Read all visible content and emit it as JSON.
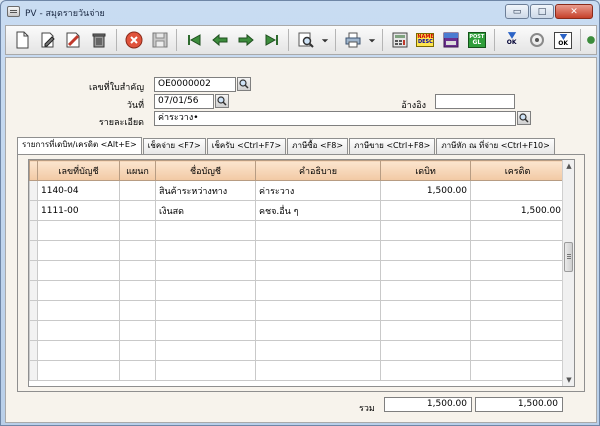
{
  "window": {
    "title": "PV - สมุดรายวันจ่าย"
  },
  "window_controls": {
    "minimize": "▭",
    "maximize": "□",
    "close": "✕"
  },
  "toolbar": {
    "icons": [
      "new-icon",
      "edit-icon",
      "delete-icon",
      "trash-icon",
      "cancel-icon",
      "save-icon",
      "first-icon",
      "prev-icon",
      "next-icon",
      "last-icon",
      "find-icon",
      "print-icon",
      "calculator-icon",
      "name-desc-icon",
      "report-icon",
      "post-gl-icon",
      "ok-icon",
      "attach-icon",
      "approve-icon",
      "exit-icon"
    ],
    "name_desc_label_1": "NAME",
    "name_desc_label_2": "DESC",
    "post_gl_label_1": "POST",
    "post_gl_label_2": "GL",
    "ok_label": "OK",
    "approve_label": "OK"
  },
  "form": {
    "doc_no_label": "เลขที่ใบสำคัญ",
    "doc_no_value": "OE0000002",
    "date_label": "วันที่",
    "date_value": "07/01/56",
    "reference_label": "อ้างอิง",
    "reference_value": "",
    "detail_label": "รายละเอียด",
    "detail_value": "ค่าระวาง•"
  },
  "tabs": [
    {
      "label": "รายการที่เดบิท/เครดิต <Alt+E>",
      "active": true
    },
    {
      "label": "เช็คจ่าย <F7>"
    },
    {
      "label": "เช็ครับ <Ctrl+F7>"
    },
    {
      "label": "ภาษีซื้อ <F8>"
    },
    {
      "label": "ภาษีขาย <Ctrl+F8>"
    },
    {
      "label": "ภาษีหัก ณ ที่จ่าย <Ctrl+F10>"
    }
  ],
  "grid": {
    "columns": [
      "เลขที่บัญชี",
      "แผนก",
      "ชื่อบัญชี",
      "คำอธิบาย",
      "เดบิท",
      "เครดิต"
    ],
    "rows": [
      {
        "account_no": "1140-04",
        "dept": "",
        "account_name": "สินค้าระหว่างทาง",
        "description": "ค่าระวาง",
        "debit": "1,500.00",
        "credit": ""
      },
      {
        "account_no": "1111-00",
        "dept": "",
        "account_name": "เงินสด",
        "description": "คชจ.อื่น ๆ",
        "debit": "",
        "credit": "1,500.00"
      }
    ],
    "empty_row_count": 8
  },
  "totals": {
    "label": "รวม",
    "debit": "1,500.00",
    "credit": "1,500.00"
  },
  "colors": {
    "grid_header": "#f2c9a4",
    "form_bg": "#f7f3ec",
    "window_frame": "#c9dcf2"
  }
}
